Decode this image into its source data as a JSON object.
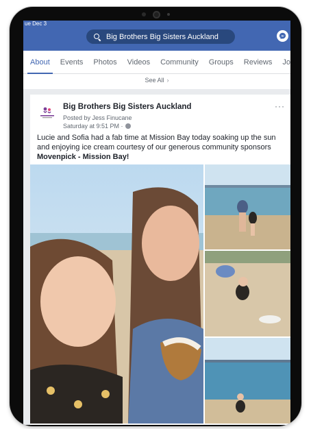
{
  "status_bar": {
    "date": "ue Dec 3"
  },
  "header": {
    "search_text": "Big Brothers Big Sisters Auckland"
  },
  "tabs": [
    {
      "label": "About"
    },
    {
      "label": "Events"
    },
    {
      "label": "Photos"
    },
    {
      "label": "Videos"
    },
    {
      "label": "Community"
    },
    {
      "label": "Groups"
    },
    {
      "label": "Reviews"
    },
    {
      "label": "Jo"
    }
  ],
  "see_all": {
    "label": "See All"
  },
  "post": {
    "page_name": "Big Brothers Big Sisters Auckland",
    "posted_by": "Posted by Jess Finucane",
    "time": "Saturday at 9:51 PM ·",
    "text": "Lucie and Sofia had a fab time at Mission Bay today soaking up the sun and enjoying ice cream courtesy of our generous community sponsors ",
    "text_bold": "Movenpick - Mission Bay!",
    "more_label": "···"
  },
  "colors": {
    "facebook_blue": "#4267b2",
    "search_bg": "#29487d"
  }
}
